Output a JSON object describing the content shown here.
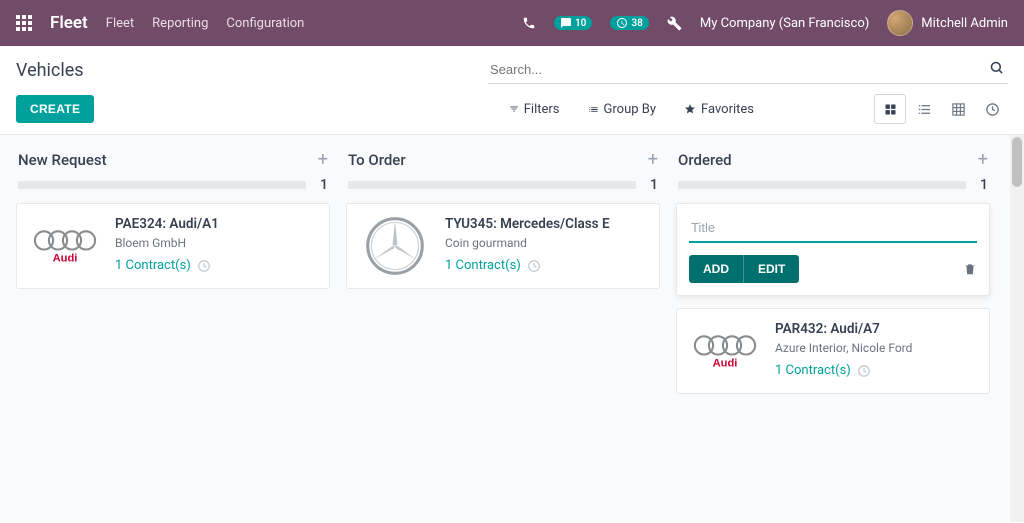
{
  "navbar": {
    "brand": "Fleet",
    "links": [
      "Fleet",
      "Reporting",
      "Configuration"
    ],
    "msg_badge": "10",
    "activity_badge": "38",
    "company": "My Company (San Francisco)",
    "user": "Mitchell Admin"
  },
  "page": {
    "title": "Vehicles",
    "create_label": "CREATE",
    "search_placeholder": "Search...",
    "filters": "Filters",
    "groupby": "Group By",
    "favorites": "Favorites"
  },
  "columns": [
    {
      "title": "New Request",
      "count": "1",
      "cards": [
        {
          "title": "PAE324: Audi/A1",
          "subtitle": "Bloem GmbH",
          "contracts": "1 Contract(s)",
          "logo": "audi"
        }
      ]
    },
    {
      "title": "To Order",
      "count": "1",
      "cards": [
        {
          "title": "TYU345: Mercedes/Class E",
          "subtitle": "Coin gourmand",
          "contracts": "1 Contract(s)",
          "logo": "mercedes"
        }
      ]
    },
    {
      "title": "Ordered",
      "count": "1",
      "quick_create": {
        "placeholder": "Title",
        "add": "ADD",
        "edit": "EDIT"
      },
      "cards": [
        {
          "title": "PAR432: Audi/A7",
          "subtitle": "Azure Interior, Nicole Ford",
          "contracts": "1 Contract(s)",
          "logo": "audi"
        }
      ]
    }
  ]
}
